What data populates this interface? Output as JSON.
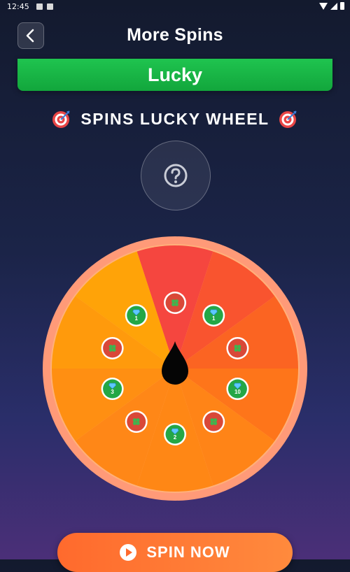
{
  "status_bar": {
    "time": "12:45"
  },
  "header": {
    "title": "More Spins"
  },
  "banner": {
    "label": "Lucky"
  },
  "subtitle": {
    "text": "SPINS LUCKY WHEEL",
    "icon": "target-icon"
  },
  "help": {
    "icon": "question-circle-icon"
  },
  "wheel": {
    "segments": 10,
    "center_icon": "pointer-drop-icon",
    "prizes": [
      {
        "type": "clover",
        "label": ""
      },
      {
        "type": "gem",
        "label": "1"
      },
      {
        "type": "clover",
        "label": ""
      },
      {
        "type": "gem",
        "label": "10"
      },
      {
        "type": "clover",
        "label": ""
      },
      {
        "type": "gem",
        "label": "2"
      },
      {
        "type": "clover",
        "label": ""
      },
      {
        "type": "gem",
        "label": "3"
      },
      {
        "type": "clover",
        "label": ""
      },
      {
        "type": "gem",
        "label": "1"
      }
    ],
    "colors": {
      "segments": [
        "#f5463f",
        "#f9542f",
        "#fb6422",
        "#fe751a",
        "#ff8417",
        "#ff8715",
        "#ff8717",
        "#ff8f12",
        "#ff9a0c",
        "#ffa308"
      ],
      "outer_rim": "#ff9a78",
      "inner_rim": "#ffb07a",
      "gem_chip": "#24a746",
      "clover_chip": "#d94838"
    }
  },
  "spin_button": {
    "label": "SPIN NOW"
  }
}
